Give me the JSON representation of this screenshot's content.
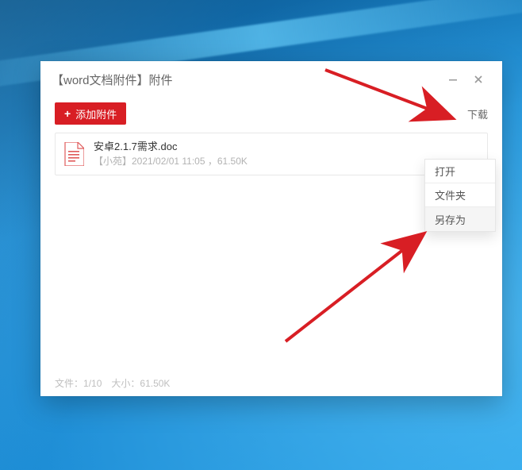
{
  "window": {
    "title": "【word文档附件】附件"
  },
  "toolbar": {
    "add_label": "添加附件",
    "download_label": "下载"
  },
  "files": [
    {
      "name": "安卓2.1.7需求.doc",
      "meta": "【小苑】2021/02/01 11:05 ，61.50K"
    }
  ],
  "context_menu": {
    "open": "打开",
    "folder": "文件夹",
    "save_as": "另存为"
  },
  "status": {
    "files_label": "文件：",
    "files_value": "1/10",
    "size_label": "大小：",
    "size_value": "61.50K"
  }
}
